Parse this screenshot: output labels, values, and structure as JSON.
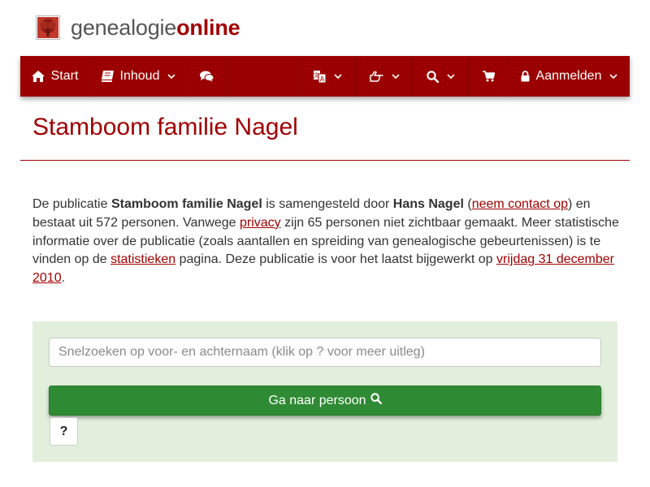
{
  "brand": {
    "name_part1": "genealogie",
    "name_part2": "online",
    "logo_icon": "tree-icon"
  },
  "nav": {
    "start_label": "Start",
    "inhoud_label": "Inhoud",
    "login_label": "Aanmelden",
    "icons": [
      "home-icon",
      "book-icon",
      "comments-icon",
      "language-icon",
      "hand-pointer-icon",
      "search-icon",
      "cart-icon",
      "lock-icon"
    ]
  },
  "page": {
    "title": "Stamboom familie Nagel"
  },
  "intro": {
    "t1": "De publicatie ",
    "publication": "Stamboom familie Nagel",
    "t2": " is samengesteld door ",
    "author": "Hans Nagel",
    "t3": " (",
    "contact_link": "neem contact op",
    "t4": ") en bestaat uit 572 personen. Vanwege ",
    "privacy_link": "privacy",
    "t5": " zijn 65 personen niet zichtbaar gemaakt. Meer statistische informatie over de publicatie (zoals aantallen en spreiding van genealogische gebeurtenissen) is te vinden op de ",
    "stats_link": "statistieken",
    "t6": " pagina. Deze publicatie is voor het laatst bijgewerkt op ",
    "date_link": "vrijdag 31 december 2010",
    "t7": "."
  },
  "search": {
    "placeholder": "Snelzoeken op voor- en achternaam (klik op ? voor meer uitleg)",
    "value": "",
    "go_label": "Ga naar persoon",
    "help_label": "?"
  },
  "colors": {
    "brand_red": "#9b0000",
    "title_red": "#a00000",
    "link_red": "#a00000",
    "panel_green": "#e2efdc",
    "button_green": "#2f8a34"
  }
}
